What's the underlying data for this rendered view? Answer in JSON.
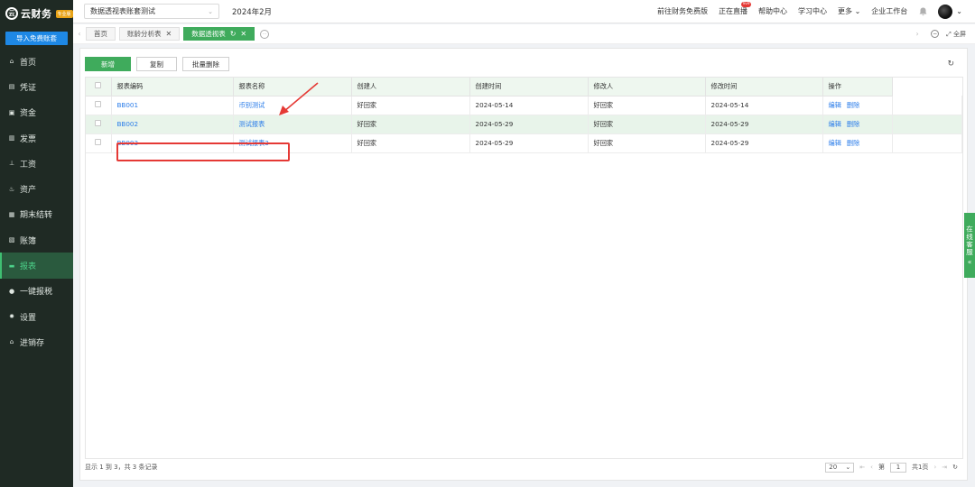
{
  "brand": {
    "name": "云财务",
    "badge": "专业版"
  },
  "sidebar": {
    "import_button": "导入免费账套",
    "items": [
      {
        "label": "首页",
        "icon": "home-icon",
        "glyph": "⌂"
      },
      {
        "label": "凭证",
        "icon": "voucher-icon",
        "glyph": "▤"
      },
      {
        "label": "资金",
        "icon": "fund-icon",
        "glyph": "▣"
      },
      {
        "label": "发票",
        "icon": "invoice-icon",
        "glyph": "▥"
      },
      {
        "label": "工资",
        "icon": "salary-icon",
        "glyph": "⊥"
      },
      {
        "label": "资产",
        "icon": "asset-icon",
        "glyph": "♨"
      },
      {
        "label": "期末结转",
        "icon": "period-close-icon",
        "glyph": "▦"
      },
      {
        "label": "账簿",
        "icon": "ledger-icon",
        "glyph": "▧"
      },
      {
        "label": "报表",
        "icon": "report-icon",
        "glyph": "▬"
      },
      {
        "label": "一键报税",
        "icon": "tax-icon",
        "glyph": "●"
      },
      {
        "label": "设置",
        "icon": "settings-icon",
        "glyph": "✹"
      },
      {
        "label": "进销存",
        "icon": "inventory-icon",
        "glyph": "⌂"
      }
    ],
    "active_index": 8
  },
  "header": {
    "account": "数据透视表账套测试",
    "period": "2024年2月",
    "links": [
      "前往财务免费版",
      "正在直播",
      "帮助中心",
      "学习中心",
      "更多",
      "企业工作台"
    ],
    "live_badge": "live"
  },
  "tabs": {
    "items": [
      {
        "label": "首页",
        "closable": false,
        "active": false
      },
      {
        "label": "账龄分析表",
        "closable": true,
        "active": false
      },
      {
        "label": "数据透视表",
        "closable": true,
        "active": true
      }
    ],
    "fullscreen": "全屏"
  },
  "toolbar": {
    "add": "新增",
    "copy": "复制",
    "batch_delete": "批量删除"
  },
  "table": {
    "columns": [
      "报表编码",
      "报表名称",
      "创建人",
      "创建时间",
      "修改人",
      "修改时间",
      "操作"
    ],
    "rows": [
      {
        "code": "BB001",
        "name": "币别测试",
        "creator": "好回家",
        "created": "2024-05-14",
        "modifier": "好回家",
        "modified": "2024-05-14",
        "edit": "编辑",
        "delete": "删除"
      },
      {
        "code": "BB002",
        "name": "测试报表",
        "creator": "好回家",
        "created": "2024-05-29",
        "modifier": "好回家",
        "modified": "2024-05-29",
        "edit": "编辑",
        "delete": "删除"
      },
      {
        "code": "BB003",
        "name": "测试报表3",
        "creator": "好回家",
        "created": "2024-05-29",
        "modifier": "好回家",
        "modified": "2024-05-29",
        "edit": "编辑",
        "delete": "删除"
      }
    ],
    "selected_row": 1
  },
  "footer": {
    "summary": "显示 1 到 3，共 3 条记录",
    "page_size": "20",
    "page_prefix": "第",
    "page_value": "1",
    "page_total": "共1页"
  },
  "service": {
    "label": "在线客服"
  },
  "colors": {
    "accent": "#3fab5c",
    "sidebar_bg": "#1f2a24",
    "link": "#2b7de9",
    "annotation": "#e53935"
  }
}
